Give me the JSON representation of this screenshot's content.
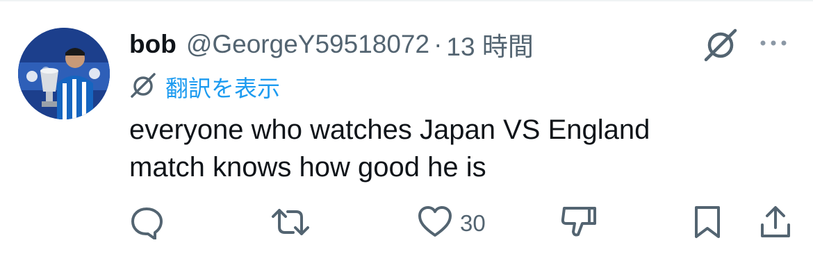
{
  "tweet": {
    "display_name": "bob",
    "handle": "@GeorgeY59518072",
    "separator": "·",
    "time": "13 時間",
    "translate_label": "翻訳を表示",
    "text_line1": "everyone who watches Japan VS England",
    "text_line2": "match knows how good he is"
  },
  "actions": {
    "reply_icon": "reply-icon",
    "retweet_icon": "retweet-icon",
    "like_icon": "heart-icon",
    "like_count": "30",
    "dislike_icon": "dislike-icon",
    "bookmark_icon": "bookmark-icon",
    "share_icon": "share-icon"
  },
  "colors": {
    "text_primary": "#0f1419",
    "text_secondary": "#536471",
    "link": "#1d9bf0"
  }
}
